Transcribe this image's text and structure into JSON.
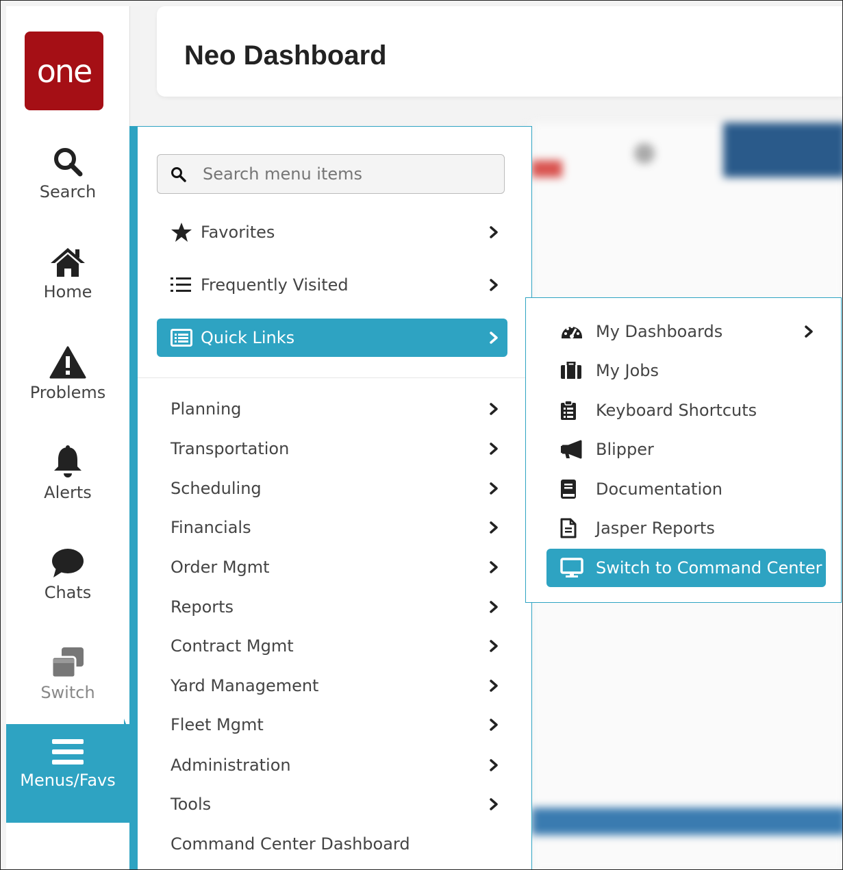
{
  "app": {
    "logo_text": "one",
    "brand_color": "#a50f15",
    "accent_color": "#2ea3c2"
  },
  "nav": {
    "items": [
      {
        "label": "Search",
        "icon": "search-icon"
      },
      {
        "label": "Home",
        "icon": "home-icon"
      },
      {
        "label": "Problems",
        "icon": "warning-icon"
      },
      {
        "label": "Alerts",
        "icon": "bell-icon"
      },
      {
        "label": "Chats",
        "icon": "chat-icon"
      },
      {
        "label": "Switch",
        "icon": "switch-icon"
      },
      {
        "label": "Menus/Favs",
        "icon": "menu-icon",
        "active": true
      }
    ]
  },
  "header": {
    "title": "Neo Dashboard"
  },
  "menu": {
    "search_placeholder": "Search menu items",
    "top_items": [
      {
        "label": "Favorites",
        "icon": "star-icon"
      },
      {
        "label": "Frequently Visited",
        "icon": "list-icon"
      },
      {
        "label": "Quick Links",
        "icon": "quick-links-icon",
        "selected": true
      }
    ],
    "items": [
      {
        "label": "Planning"
      },
      {
        "label": "Transportation"
      },
      {
        "label": "Scheduling"
      },
      {
        "label": "Financials"
      },
      {
        "label": "Order Mgmt"
      },
      {
        "label": "Reports"
      },
      {
        "label": "Contract Mgmt"
      },
      {
        "label": "Yard Management"
      },
      {
        "label": "Fleet Mgmt"
      },
      {
        "label": "Administration"
      },
      {
        "label": "Tools"
      },
      {
        "label": "Command Center Dashboard"
      }
    ]
  },
  "submenu": {
    "items": [
      {
        "label": "My Dashboards",
        "icon": "dashboard-icon"
      },
      {
        "label": "My Jobs",
        "icon": "jobs-icon"
      },
      {
        "label": "Keyboard Shortcuts",
        "icon": "clipboard-icon"
      },
      {
        "label": "Blipper",
        "icon": "megaphone-icon"
      },
      {
        "label": "Documentation",
        "icon": "book-icon"
      },
      {
        "label": "Jasper Reports",
        "icon": "file-icon"
      },
      {
        "label": "Switch to Command Center",
        "icon": "monitor-icon",
        "selected": true
      }
    ]
  }
}
